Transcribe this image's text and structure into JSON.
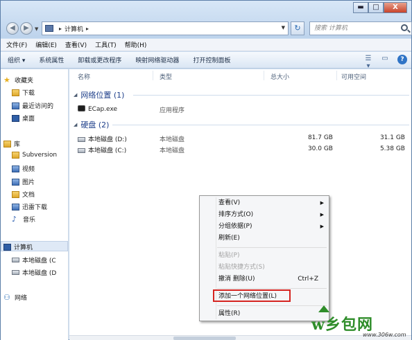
{
  "window": {
    "caption_minimize": "▬",
    "caption_maximize": "□",
    "caption_close": "X"
  },
  "address": {
    "current": "计算机",
    "search_placeholder": "搜索 计算机"
  },
  "menu": [
    "文件(F)",
    "编辑(E)",
    "查看(V)",
    "工具(T)",
    "帮助(H)"
  ],
  "toolbar": {
    "organize": "组织 ▾",
    "buttons": [
      "系统属性",
      "卸载或更改程序",
      "映射网络驱动器",
      "打开控制面板"
    ],
    "help": "?"
  },
  "nav": {
    "favorites": "收藏夹",
    "downloads": "下载",
    "recent": "最近访问的",
    "desktop": "桌面",
    "library": "库",
    "subversion": "Subversion",
    "videos": "视频",
    "pictures": "图片",
    "documents": "文档",
    "thunder": "迅雷下载",
    "music": "音乐",
    "computer": "计算机",
    "drive_c": "本地磁盘 (C",
    "drive_d": "本地磁盘 (D",
    "network": "网络"
  },
  "columns": {
    "name": "名称",
    "type": "类型",
    "total": "总大小",
    "free": "可用空间"
  },
  "groups": {
    "network_locations": "网络位置 (1)",
    "hard_disks": "硬盘 (2)"
  },
  "network_items": [
    {
      "name": "ECap.exe",
      "type": "应用程序"
    }
  ],
  "disks": [
    {
      "name": "本地磁盘 (D:)",
      "type": "本地磁盘",
      "total": "81.7 GB",
      "free": "31.1 GB"
    },
    {
      "name": "本地磁盘 (C:)",
      "type": "本地磁盘",
      "total": "30.0 GB",
      "free": "5.38 GB"
    }
  ],
  "context_menu": {
    "view": "查看(V)",
    "sort": "排序方式(O)",
    "group": "分组依据(P)",
    "refresh": "刷新(E)",
    "paste": "粘贴(P)",
    "paste_shortcut": "粘贴快捷方式(S)",
    "undo": "撤消 删除(U)",
    "undo_shortcut": "Ctrl+Z",
    "add_network_location": "添加一个网络位置(L)",
    "properties": "属性(R)"
  },
  "watermark": {
    "text": "w乡包网",
    "url": "www.306w.com"
  }
}
